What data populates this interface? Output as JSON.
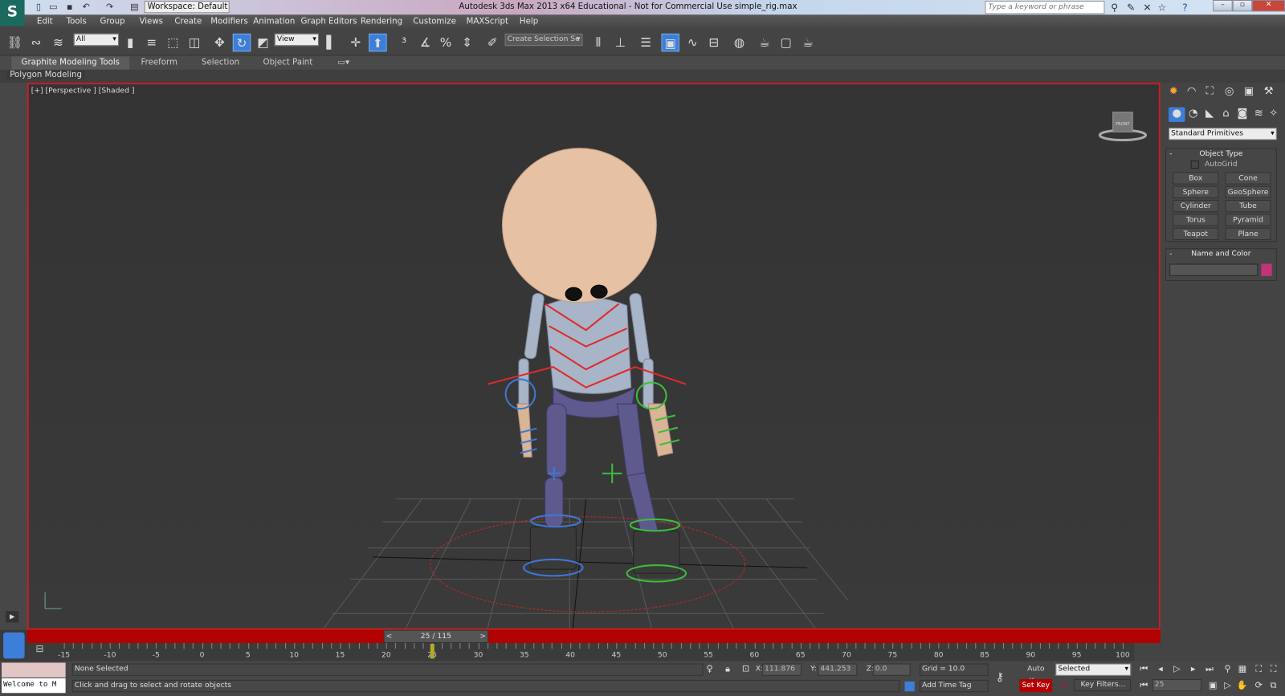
{
  "app": {
    "title": "Autodesk 3ds Max  2013 x64   Educational - Not for Commercial Use    simple_rig.max",
    "workspace": "Workspace: Default",
    "search_placeholder": "Type a keyword or phrase"
  },
  "menu": [
    "Edit",
    "Tools",
    "Group",
    "Views",
    "Create",
    "Modifiers",
    "Animation",
    "Graph Editors",
    "Rendering",
    "Customize",
    "MAXScript",
    "Help"
  ],
  "toolbar": {
    "selection_filter": "All",
    "ref_coord": "View",
    "named_selection": "Create Selection Se"
  },
  "ribbon": {
    "tabs": [
      "Graphite Modeling Tools",
      "Freeform",
      "Selection",
      "Object Paint"
    ],
    "panel": "Polygon Modeling"
  },
  "viewport": {
    "label": "[+] [Perspective ] [Shaded ]",
    "viewcube_face": "FRONT"
  },
  "command_panel": {
    "category": "Standard Primitives",
    "object_type_title": "Object Type",
    "autogrid": "AutoGrid",
    "buttons": [
      "Box",
      "Cone",
      "Sphere",
      "GeoSphere",
      "Cylinder",
      "Tube",
      "Torus",
      "Pyramid",
      "Teapot",
      "Plane"
    ],
    "name_color_title": "Name and Color",
    "object_color": "#c2337a"
  },
  "timeline": {
    "slider": "25 / 115",
    "current_frame": 25,
    "ticks": [
      "-15",
      "-10",
      "-5",
      "0",
      "5",
      "10",
      "15",
      "20",
      "25",
      "30",
      "35",
      "40",
      "45",
      "50",
      "55",
      "60",
      "65",
      "70",
      "75",
      "80",
      "85",
      "90",
      "95",
      "100"
    ]
  },
  "status": {
    "selection": "None Selected",
    "prompt": "Click and drag to select and rotate objects",
    "maxscript": "Welcome to M",
    "x_label": "X:",
    "x": "111.876",
    "y_label": "Y:",
    "y": "441.253",
    "z_label": "Z:",
    "z": "0.0",
    "grid": "Grid = 10.0",
    "add_time_tag": "Add Time Tag",
    "auto_key": "Auto Key",
    "set_key": "Set Key",
    "key_mode": "Selected",
    "key_filters": "Key Filters...",
    "frame": "25"
  }
}
